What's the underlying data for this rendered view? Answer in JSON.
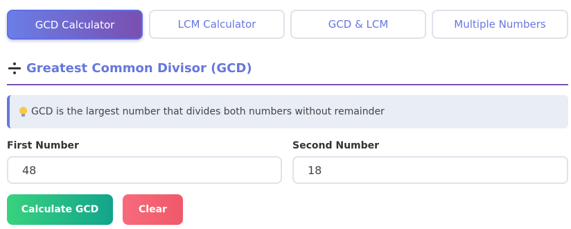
{
  "tabs": [
    {
      "label": "GCD Calculator",
      "active": true
    },
    {
      "label": "LCM Calculator",
      "active": false
    },
    {
      "label": "GCD & LCM",
      "active": false
    },
    {
      "label": "Multiple Numbers",
      "active": false
    }
  ],
  "section": {
    "icon": "divide-icon",
    "title": "Greatest Common Divisor (GCD)"
  },
  "info": {
    "icon": "lightbulb-icon",
    "text": "GCD is the largest number that divides both numbers without remainder"
  },
  "form": {
    "first_label": "First Number",
    "first_value": "48",
    "second_label": "Second Number",
    "second_value": "18"
  },
  "buttons": {
    "calculate": "Calculate GCD",
    "clear": "Clear"
  },
  "colors": {
    "accent": "#6677dd",
    "active_tab_gradient": [
      "#6a7ee7",
      "#7a4fb0"
    ],
    "calculate_gradient": [
      "#38d27e",
      "#12a48c"
    ],
    "clear_color": "#f76b7c"
  }
}
